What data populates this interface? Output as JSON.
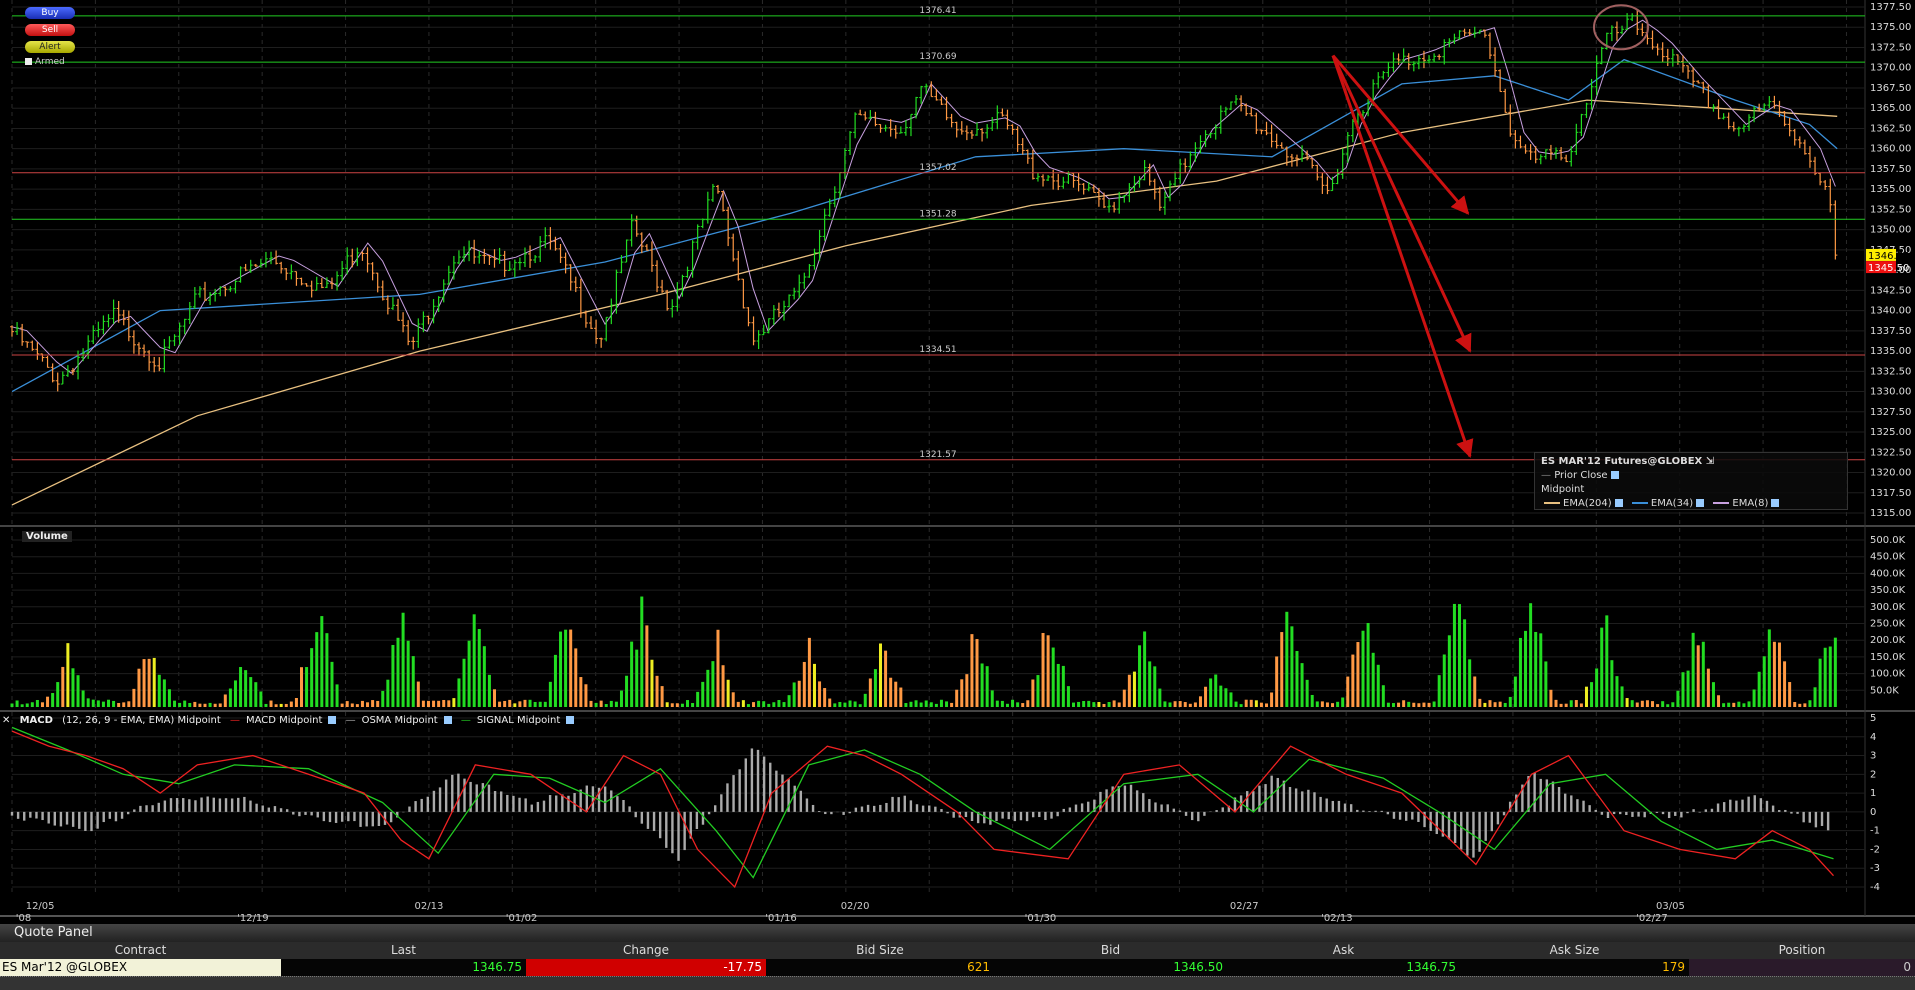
{
  "controls": {
    "buy": "Buy",
    "sell": "Sell",
    "alert": "Alert",
    "armed": "Armed"
  },
  "legend": {
    "title": "ES MAR'12 Futures@GLOBEX",
    "prior_close": "Prior Close",
    "midpoint": "Midpoint",
    "ema_long": "EMA(204)",
    "ema_mid": "EMA(34)",
    "ema_short": "EMA(8)"
  },
  "volume_panel": {
    "title": "Volume"
  },
  "macd_panel": {
    "title": "MACD",
    "params": "(12, 26, 9 - EMA, EMA) Midpoint",
    "macd_label": "MACD Midpoint",
    "osma_label": "OSMA Midpoint",
    "signal_label": "SIGNAL Midpoint"
  },
  "quote_panel": {
    "title": "Quote Panel",
    "columns": [
      "Contract",
      "Last",
      "Change",
      "Bid Size",
      "Bid",
      "Ask",
      "Ask Size",
      "Position"
    ],
    "row": {
      "contract": "ES Mar'12 @GLOBEX",
      "last": "1346.75",
      "change": "-17.75",
      "bid_size": "621",
      "bid": "1346.50",
      "ask": "1346.75",
      "ask_size": "179",
      "position": "0"
    }
  },
  "colors": {
    "up_bar": "#22dd22",
    "down_bar": "#ff9944",
    "ema204": "#e8c080",
    "ema34": "#3a8fd8",
    "ema8": "#c8a0e0",
    "macd": "#ee2222",
    "signal": "#22cc22",
    "osma": "#aaaaaa",
    "arrow": "#cc1111",
    "green_level": "#22cc22",
    "red_level": "#cc4444"
  },
  "chart_data": [
    {
      "type": "candlestick",
      "ylim": [
        1315,
        1377.5
      ],
      "y_ticks": [
        "1377.50",
        "1375.00",
        "1372.50",
        "1370.00",
        "1367.50",
        "1365.00",
        "1362.50",
        "1360.00",
        "1357.50",
        "1355.00",
        "1352.50",
        "1350.00",
        "1347.50",
        "1345.00",
        "1342.50",
        "1340.00",
        "1337.50",
        "1335.00",
        "1332.50",
        "1330.00",
        "1327.50",
        "1325.00",
        "1322.50",
        "1320.00",
        "1317.50",
        "1315.00"
      ],
      "price_markers": {
        "last": "1346.75",
        "bid": "1345.50"
      },
      "horizontal_levels": [
        {
          "value": 1376.41,
          "label": "1376.41",
          "color": "green"
        },
        {
          "value": 1370.69,
          "label": "1370.69",
          "color": "green"
        },
        {
          "value": 1357.02,
          "label": "1357.02",
          "color": "red"
        },
        {
          "value": 1351.28,
          "label": "1351.28",
          "color": "green"
        },
        {
          "value": 1334.51,
          "label": "1334.51",
          "color": "red"
        },
        {
          "value": 1321.57,
          "label": "1321.57",
          "color": "red"
        }
      ],
      "price_path": [
        [
          0,
          1338
        ],
        [
          2.5,
          1332
        ],
        [
          5.5,
          1340
        ],
        [
          8,
          1334
        ],
        [
          10,
          1342
        ],
        [
          14,
          1347
        ],
        [
          17,
          1343
        ],
        [
          18.8,
          1349
        ],
        [
          21.5,
          1336
        ],
        [
          24,
          1348
        ],
        [
          26,
          1346
        ],
        [
          29,
          1349
        ],
        [
          31.7,
          1337
        ],
        [
          33.5,
          1351
        ],
        [
          35.5,
          1341
        ],
        [
          38,
          1356
        ],
        [
          40,
          1337
        ],
        [
          42.5,
          1343
        ],
        [
          45.5,
          1364
        ],
        [
          48,
          1363
        ],
        [
          49,
          1368
        ],
        [
          51,
          1363
        ],
        [
          53.5,
          1364
        ],
        [
          55,
          1358
        ],
        [
          57.5,
          1356
        ],
        [
          59,
          1353
        ],
        [
          61,
          1358
        ],
        [
          62,
          1353
        ],
        [
          64,
          1362
        ],
        [
          66,
          1366
        ],
        [
          68,
          1362
        ],
        [
          70,
          1358
        ],
        [
          71,
          1355
        ],
        [
          72.5,
          1365
        ],
        [
          74.5,
          1371
        ],
        [
          76,
          1372
        ],
        [
          78,
          1374
        ],
        [
          79.5,
          1375
        ],
        [
          81,
          1362
        ],
        [
          82,
          1359
        ],
        [
          84,
          1360
        ],
        [
          86,
          1374
        ],
        [
          87.5,
          1376
        ],
        [
          89,
          1373
        ],
        [
          90.5,
          1369
        ],
        [
          93,
          1363
        ],
        [
          95,
          1366
        ],
        [
          97,
          1360
        ],
        [
          98.2,
          1353
        ],
        [
          98.4,
          1347
        ]
      ],
      "ema204_path": [
        [
          0,
          1316
        ],
        [
          10,
          1327
        ],
        [
          22,
          1335
        ],
        [
          35,
          1342
        ],
        [
          45,
          1348
        ],
        [
          55,
          1353
        ],
        [
          65,
          1356
        ],
        [
          75,
          1362
        ],
        [
          85,
          1366
        ],
        [
          92,
          1365
        ],
        [
          98.5,
          1364
        ]
      ],
      "ema34_path": [
        [
          0,
          1330
        ],
        [
          8,
          1340
        ],
        [
          22,
          1342
        ],
        [
          32,
          1346
        ],
        [
          42,
          1352
        ],
        [
          52,
          1359
        ],
        [
          60,
          1360
        ],
        [
          68,
          1359
        ],
        [
          75,
          1368
        ],
        [
          80,
          1369
        ],
        [
          84,
          1366
        ],
        [
          87,
          1371
        ],
        [
          93,
          1366
        ],
        [
          97,
          1363
        ],
        [
          98.5,
          1360
        ]
      ],
      "arrows": [
        {
          "from": [
            1333,
            1371.5
          ],
          "to": [
            1468,
            1352
          ]
        },
        {
          "from": [
            1333,
            1371.5
          ],
          "to": [
            1470,
            1335
          ]
        },
        {
          "from": [
            1333,
            1371.5
          ],
          "to": [
            1470,
            1322
          ]
        }
      ],
      "x_ticks": [
        {
          "label": "'08",
          "pos": 0.2
        },
        {
          "label": "12/05",
          "pos": 0.2
        },
        {
          "label": "'12/19",
          "pos": 13
        },
        {
          "label": "02/13",
          "pos": 22.5
        },
        {
          "label": "'01/02",
          "pos": 27.5
        },
        {
          "label": "'01/16",
          "pos": 41.5
        },
        {
          "label": "02/20",
          "pos": 45.5
        },
        {
          "label": "'01/30",
          "pos": 55.5
        },
        {
          "label": "02/27",
          "pos": 66.5
        },
        {
          "label": "'02/13",
          "pos": 71.5
        },
        {
          "label": "03/05",
          "pos": 89.5
        },
        {
          "label": "'02/27",
          "pos": 88.5
        }
      ]
    },
    {
      "type": "bar",
      "title": "Volume",
      "ylim": [
        0,
        500000
      ],
      "y_ticks": [
        "500.0K",
        "450.0K",
        "400.0K",
        "350.0K",
        "300.0K",
        "250.0K",
        "200.0K",
        "150.0K",
        "100.0K",
        "50.0K"
      ],
      "spikes": [
        [
          3,
          200000
        ],
        [
          7.5,
          230000
        ],
        [
          12.5,
          200000
        ],
        [
          16.5,
          400000
        ],
        [
          21,
          320000
        ],
        [
          25,
          300000
        ],
        [
          30,
          330000
        ],
        [
          34,
          380000
        ],
        [
          38,
          260000
        ],
        [
          43,
          220000
        ],
        [
          47,
          230000
        ],
        [
          52,
          260000
        ],
        [
          56,
          310000
        ],
        [
          61,
          270000
        ],
        [
          65,
          130000
        ],
        [
          69,
          360000
        ],
        [
          73,
          370000
        ],
        [
          78,
          490000
        ],
        [
          82,
          400000
        ],
        [
          86,
          300000
        ],
        [
          91,
          330000
        ],
        [
          95,
          330000
        ],
        [
          98.3,
          350000
        ]
      ]
    },
    {
      "type": "line",
      "title": "MACD",
      "ylim": [
        -4,
        5
      ],
      "y_ticks": [
        "5",
        "4",
        "3",
        "2",
        "1",
        "0",
        "-1",
        "-2",
        "-3",
        "-4"
      ],
      "macd_path": [
        [
          0,
          4.3
        ],
        [
          2,
          3.5
        ],
        [
          4,
          3
        ],
        [
          6,
          2.3
        ],
        [
          8,
          1
        ],
        [
          10,
          2.5
        ],
        [
          13,
          3
        ],
        [
          16,
          2
        ],
        [
          19,
          1
        ],
        [
          21,
          -1.5
        ],
        [
          22.5,
          -2.5
        ],
        [
          25,
          2.5
        ],
        [
          28,
          2
        ],
        [
          31,
          0
        ],
        [
          33,
          3
        ],
        [
          35,
          2
        ],
        [
          37,
          -2
        ],
        [
          39,
          -4
        ],
        [
          41,
          1
        ],
        [
          44,
          3.5
        ],
        [
          46,
          3
        ],
        [
          48,
          2
        ],
        [
          51,
          0
        ],
        [
          53,
          -2
        ],
        [
          57,
          -2.5
        ],
        [
          60,
          2
        ],
        [
          63,
          2.5
        ],
        [
          66,
          0
        ],
        [
          69,
          3.5
        ],
        [
          72,
          2
        ],
        [
          75,
          1
        ],
        [
          79,
          -2.8
        ],
        [
          82,
          2
        ],
        [
          84,
          3
        ],
        [
          87,
          -1
        ],
        [
          90,
          -2
        ],
        [
          93,
          -2.5
        ],
        [
          95,
          -1
        ],
        [
          97,
          -2
        ],
        [
          98.3,
          -3.4
        ]
      ],
      "signal_path": [
        [
          0,
          4.5
        ],
        [
          3,
          3.3
        ],
        [
          6,
          2
        ],
        [
          9,
          1.5
        ],
        [
          12,
          2.5
        ],
        [
          16,
          2.3
        ],
        [
          20,
          0.5
        ],
        [
          23,
          -2.2
        ],
        [
          26,
          2
        ],
        [
          29,
          1.8
        ],
        [
          32,
          0.5
        ],
        [
          35,
          2.3
        ],
        [
          38,
          -1
        ],
        [
          40,
          -3.5
        ],
        [
          43,
          2.5
        ],
        [
          46,
          3.3
        ],
        [
          49,
          2
        ],
        [
          52,
          0
        ],
        [
          56,
          -2
        ],
        [
          60,
          1.5
        ],
        [
          64,
          2
        ],
        [
          67,
          0
        ],
        [
          70,
          2.8
        ],
        [
          74,
          1.8
        ],
        [
          77,
          0
        ],
        [
          80,
          -2
        ],
        [
          83,
          1.5
        ],
        [
          86,
          2
        ],
        [
          89,
          -0.5
        ],
        [
          92,
          -2
        ],
        [
          95,
          -1.5
        ],
        [
          98.3,
          -2.5
        ]
      ],
      "osma_path": [
        [
          0,
          -0.2
        ],
        [
          4,
          -1
        ],
        [
          8,
          0.6
        ],
        [
          12,
          0.8
        ],
        [
          16,
          -0.3
        ],
        [
          20,
          -0.8
        ],
        [
          24,
          2
        ],
        [
          28,
          0.5
        ],
        [
          32,
          1.5
        ],
        [
          36,
          -2.5
        ],
        [
          40,
          3.5
        ],
        [
          44,
          -0.3
        ],
        [
          48,
          0.8
        ],
        [
          52,
          -0.6
        ],
        [
          56,
          -0.3
        ],
        [
          60,
          1.5
        ],
        [
          64,
          -0.5
        ],
        [
          68,
          1.8
        ],
        [
          72,
          0.4
        ],
        [
          76,
          -0.6
        ],
        [
          79,
          -2.5
        ],
        [
          82,
          2.2
        ],
        [
          86,
          -0.2
        ],
        [
          90,
          -0.2
        ],
        [
          94,
          0.9
        ],
        [
          98.3,
          -1.2
        ]
      ]
    }
  ]
}
